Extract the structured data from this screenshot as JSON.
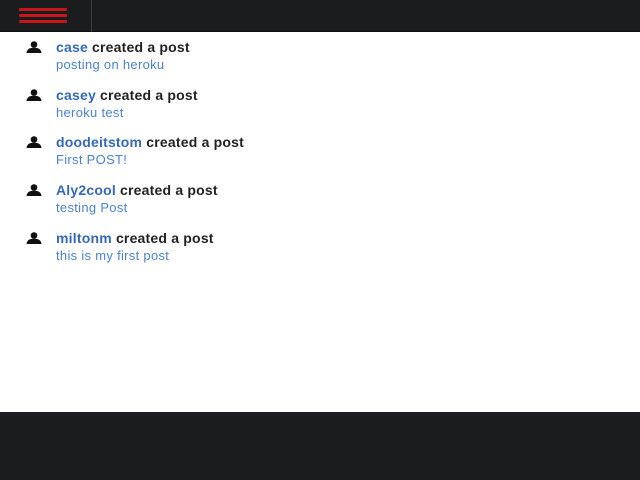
{
  "colors": {
    "topbar_bg": "#1b1c1e",
    "menu_accent": "#c8171b",
    "username": "#3568b8",
    "post_link": "#4b82cf",
    "text": "#222222"
  },
  "header": {
    "menu_icon": "hamburger-menu-icon"
  },
  "feed": {
    "items": [
      {
        "user_icon": "user-icon",
        "username": "case",
        "action": "created a post",
        "post_title": "posting on heroku"
      },
      {
        "user_icon": "user-icon",
        "username": "casey",
        "action": "created a post",
        "post_title": "heroku test"
      },
      {
        "user_icon": "user-icon",
        "username": "doodeitstom",
        "action": "created a post",
        "post_title": "First POST!"
      },
      {
        "user_icon": "user-icon",
        "username": "Aly2cool",
        "action": "created a post",
        "post_title": "testing Post"
      },
      {
        "user_icon": "user-icon",
        "username": "miltonm",
        "action": "created a post",
        "post_title": "this is my first post"
      }
    ]
  }
}
